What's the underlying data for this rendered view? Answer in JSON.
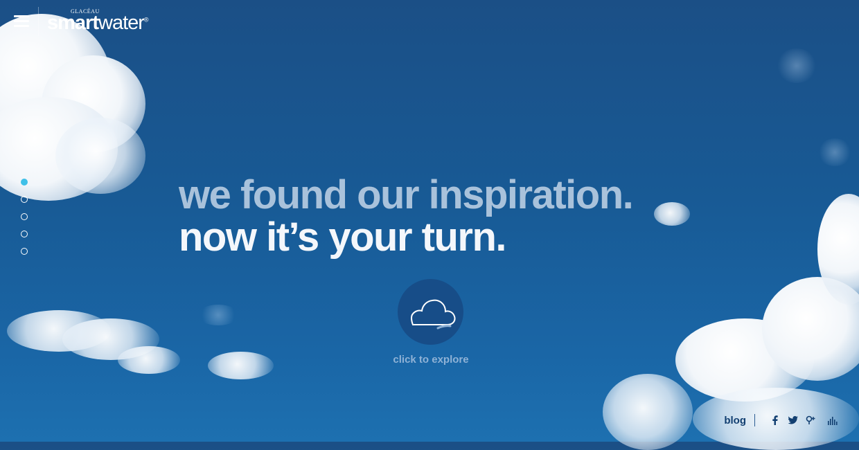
{
  "logo": {
    "small": "GLACÉAU",
    "bold": "smart",
    "light": "water",
    "registered": "®"
  },
  "hero": {
    "line1": "we found our inspiration.",
    "line2": "now it’s your turn."
  },
  "explore": {
    "label": "click to explore",
    "icon": "cloud-icon"
  },
  "slides": {
    "count": 5,
    "active_index": 0
  },
  "footer": {
    "blog_label": "blog",
    "icons": [
      "facebook-icon",
      "twitter-icon",
      "google-plus-icon",
      "audio-bars-icon"
    ]
  },
  "colors": {
    "accent": "#3fc0e8",
    "sky": "#185a95",
    "footer_text": "#123f71"
  }
}
